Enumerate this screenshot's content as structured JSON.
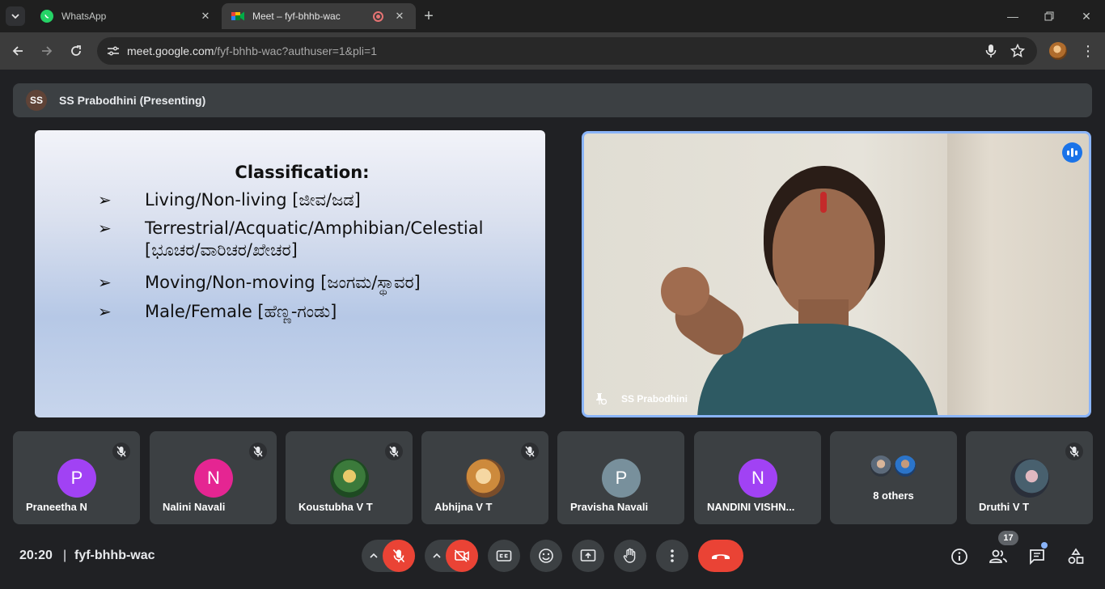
{
  "browser": {
    "tabs": [
      {
        "title": "WhatsApp",
        "active": false,
        "favicon": "whatsapp-icon"
      },
      {
        "title": "Meet – fyf-bhhb-wac",
        "active": true,
        "favicon": "google-meet-icon",
        "recording": true
      }
    ],
    "url_host": "meet.google.com",
    "url_path": "/fyf-bhhb-wac?authuser=1&pli=1"
  },
  "meet": {
    "presenter_initials": "SS",
    "presenting_label": "SS Prabodhini (Presenting)",
    "slide": {
      "title": "Classification:",
      "bullets": [
        "Living/Non-living [ಜೀವ/ಜಡ]",
        "Terrestrial/Acquatic/Amphibian/Celestial [ಭೂಚರ/ವಾರಿಚರ/ಖೇಚರ]",
        "Moving/Non-moving [ಜಂಗಮ/ಸ್ಥಾವರ]",
        "Male/Female [ಹೆಣ್ಣ-ಗಂಡು]"
      ],
      "bullet_marker": "➢"
    },
    "speaker_tile_name": "SS Prabodhini",
    "participants": [
      {
        "name": "Praneetha N",
        "initial": "P",
        "color": "#a142f4",
        "muted": true
      },
      {
        "name": "Nalini Navali",
        "initial": "N",
        "color": "#e52592",
        "muted": true
      },
      {
        "name": "Koustubha V T",
        "initial": "",
        "photo": "pic-green",
        "muted": true
      },
      {
        "name": "Abhijna V T",
        "initial": "",
        "photo": "pic-warm",
        "muted": true
      },
      {
        "name": "Pravisha Navali",
        "initial": "P",
        "color": "#78909c",
        "muted": false
      },
      {
        "name": "NANDINI VISHN...",
        "initial": "N",
        "color": "#a142f4",
        "muted": false
      },
      {
        "name": "8 others",
        "initial": "",
        "group": true,
        "muted": false
      },
      {
        "name": "Druthi V T",
        "initial": "",
        "photo": "pic-dark",
        "muted": true
      }
    ],
    "clock": "20:20",
    "separator": "|",
    "meeting_code": "fyf-bhhb-wac",
    "participant_count": "17"
  }
}
